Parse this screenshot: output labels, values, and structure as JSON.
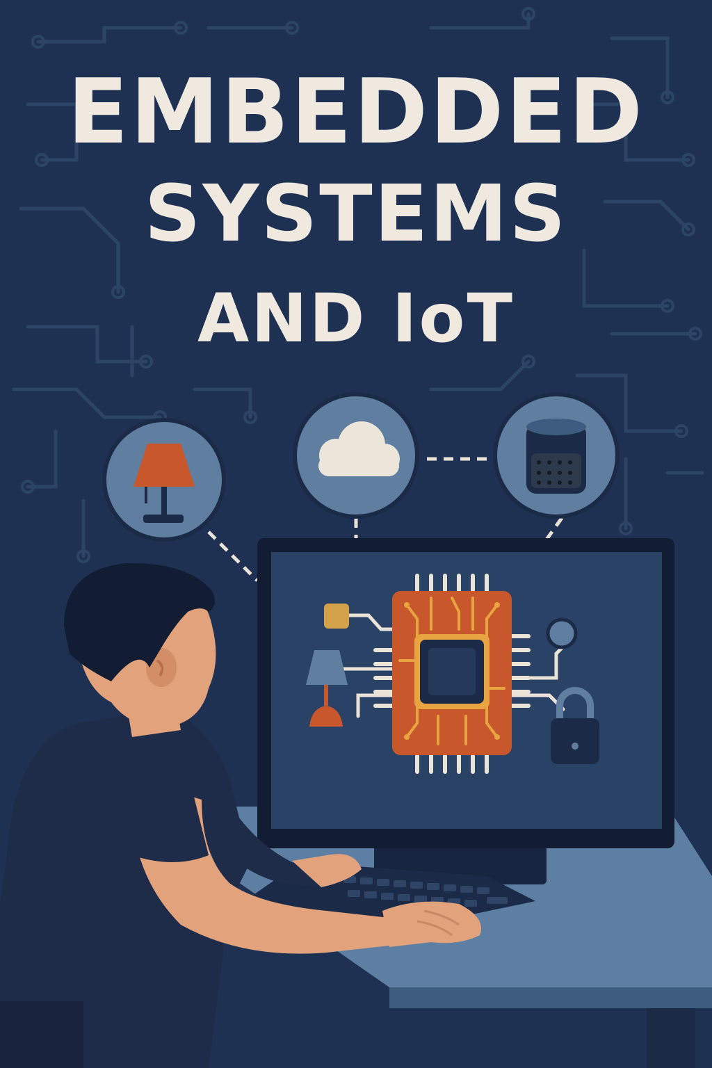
{
  "title": {
    "line1": "EMBEDDED",
    "line2": "SYSTEMS",
    "line3": "AND IoT"
  },
  "icons": [
    "lamp-icon",
    "cloud-icon",
    "smart-speaker-icon",
    "microchip-icon",
    "padlock-icon",
    "sensor-icon"
  ],
  "colors": {
    "background": "#1e3152",
    "title": "#f0e9df",
    "accent_orange": "#c8572b",
    "chip_trace": "#e8a441",
    "circle_fill": "#5f7ea0",
    "desk": "#5d7fa3"
  }
}
